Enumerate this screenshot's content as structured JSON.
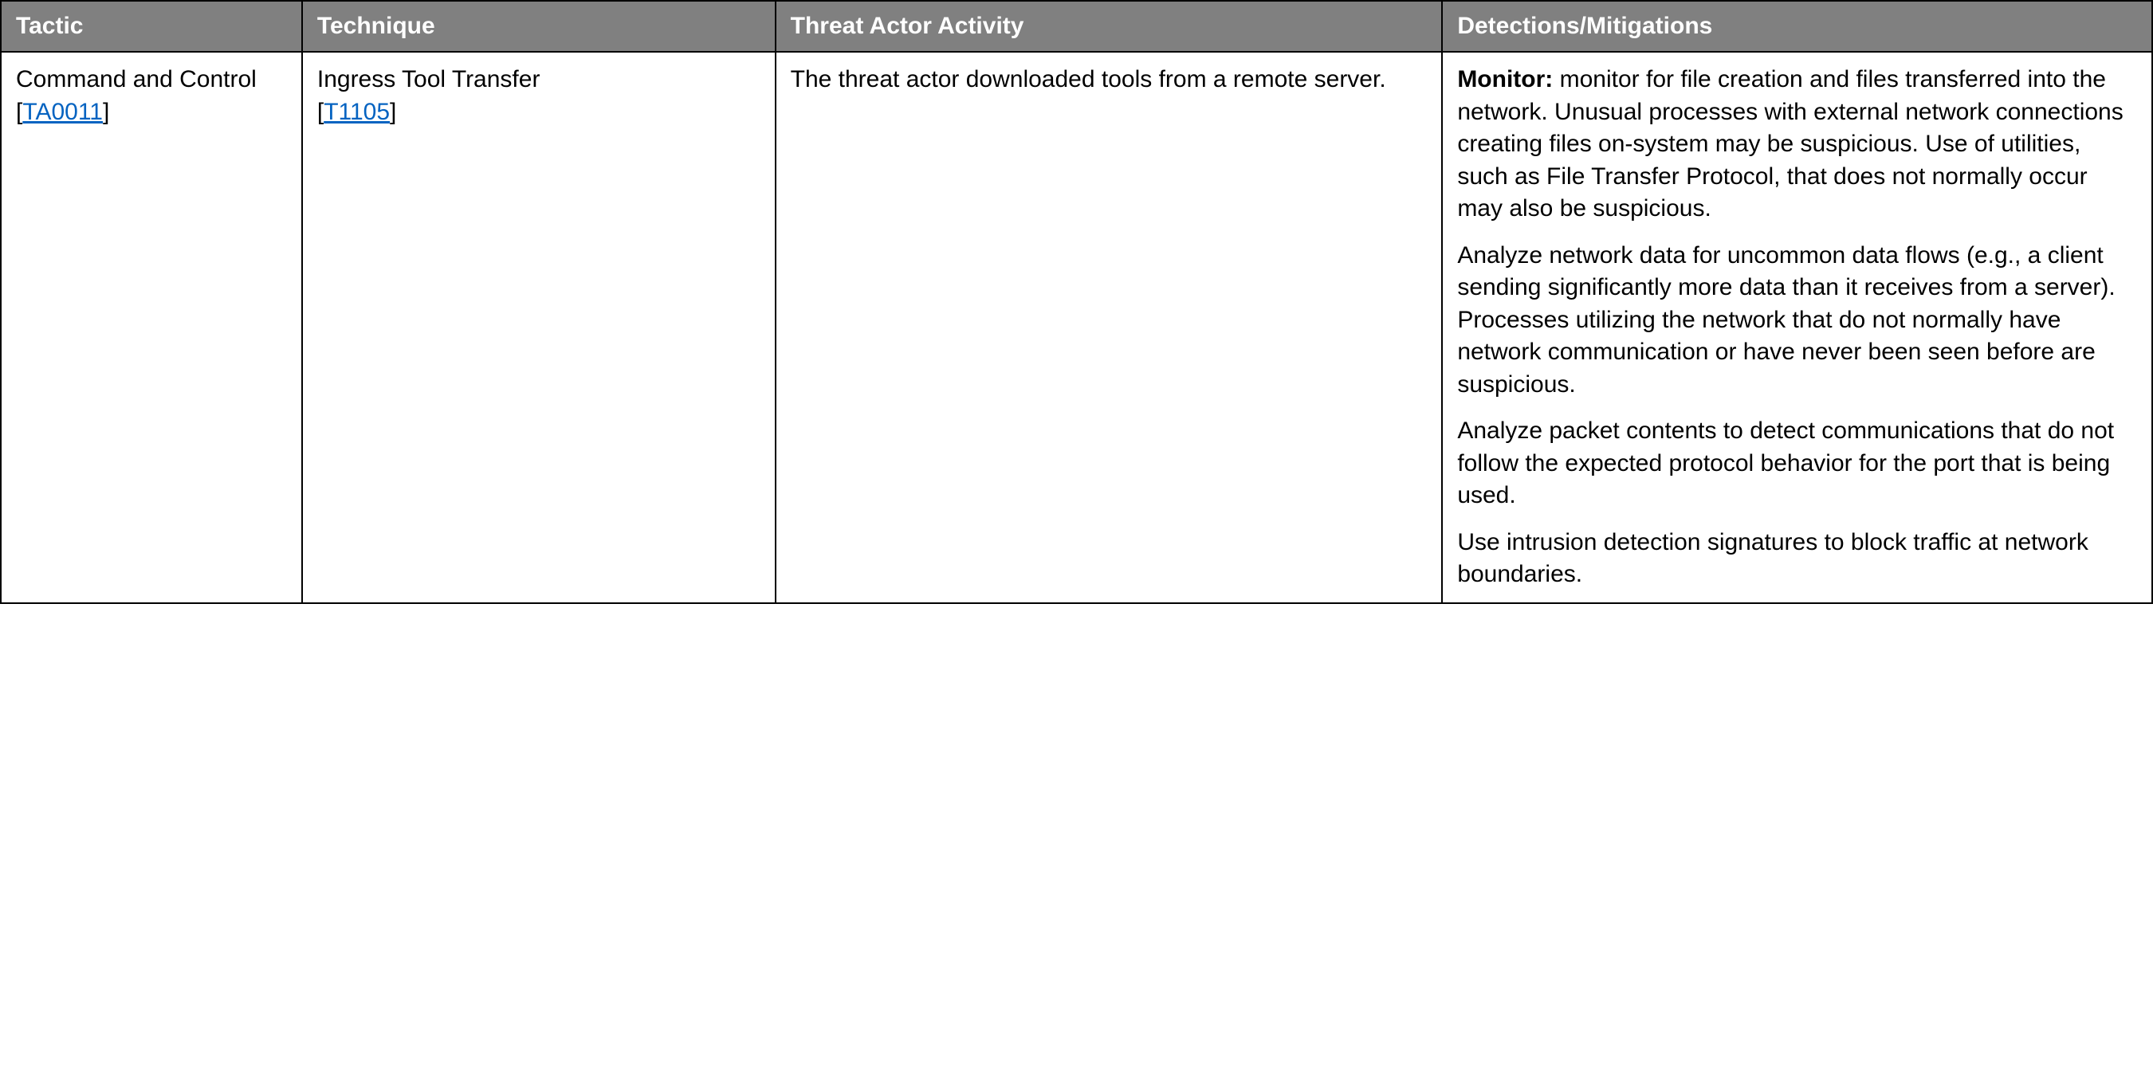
{
  "headers": {
    "tactic": "Tactic",
    "technique": "Technique",
    "activity": "Threat Actor Activity",
    "detections": "Detections/Mitigations"
  },
  "row": {
    "tactic_text": "Command and Control",
    "tactic_link": "TA0011",
    "technique_text": "Ingress Tool Transfer",
    "technique_link": "T1105",
    "activity": "The threat actor downloaded tools from a remote server.",
    "detections": {
      "monitor_label": "Monitor:",
      "p1_rest": " monitor for file creation and files transferred into the network. Unusual processes with external network connections creating files on-system may be suspicious. Use of utilities, such as File Transfer Protocol, that does not normally occur may also be suspicious.",
      "p2": "Analyze network data for uncommon data flows (e.g., a client sending significantly more data than it receives from a server). Processes utilizing the network that do not normally have network communication or have never been seen before are suspicious.",
      "p3": "Analyze packet contents to detect communications that do not follow the expected protocol behavior for the port that is being used.",
      "p4": "Use intrusion detection signatures to block traffic at network boundaries."
    }
  }
}
